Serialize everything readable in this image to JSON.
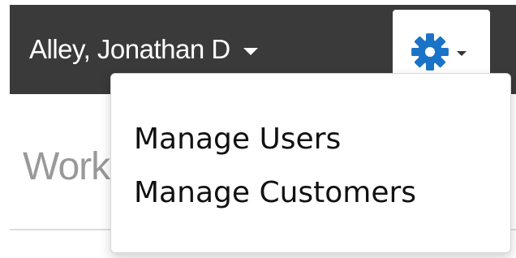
{
  "navbar": {
    "user_name": "Alley, Jonathan D",
    "settings_icon": "gear-icon",
    "accent_color": "#1a73c7",
    "background_color": "#3a3a3a"
  },
  "dropdown": {
    "items": [
      {
        "label": "Manage Users"
      },
      {
        "label": "Manage Customers"
      }
    ]
  },
  "page": {
    "heading_visible": "Work"
  }
}
